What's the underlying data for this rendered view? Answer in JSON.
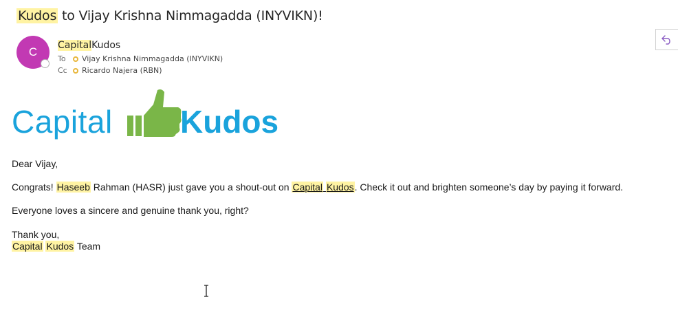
{
  "subject": {
    "highlight": "Kudos",
    "rest": " to Vijay Krishna Nimmagadda (INYVIKN)!"
  },
  "sender": {
    "avatar_initial": "C",
    "avatar_color": "#c239b3",
    "name_highlight": "Capital",
    "name_rest": "Kudos"
  },
  "recipients": {
    "to_label": "To",
    "to_value": "Vijay Krishna Nimmagadda (INYVIKN)",
    "cc_label": "Cc",
    "cc_value": "Ricardo Najera (RBN)"
  },
  "toolbar": {
    "reply_icon": "reply-icon"
  },
  "logo": {
    "left_word": "Capital",
    "right_word": "Kudos",
    "icon": "thumbs-up-icon",
    "blue": "#1aa3dc",
    "green": "#7ab648"
  },
  "body": {
    "greeting": "Dear Vijay,",
    "p1_a": "Congrats! ",
    "p1_hl_name": "Haseeb",
    "p1_b": " Rahman (HASR) just gave you a shout-out on ",
    "p1_link_a": "Capital",
    "p1_link_space": " ",
    "p1_link_b": "Kudos",
    "p1_c": ". Check it out and brighten someone’s day by paying it forward.",
    "p2": "Everyone loves a sincere and genuine thank you, right?",
    "signoff": "Thank you,",
    "team_hl_a": "Capital",
    "team_space": " ",
    "team_hl_b": "Kudos",
    "team_rest": " Team"
  }
}
